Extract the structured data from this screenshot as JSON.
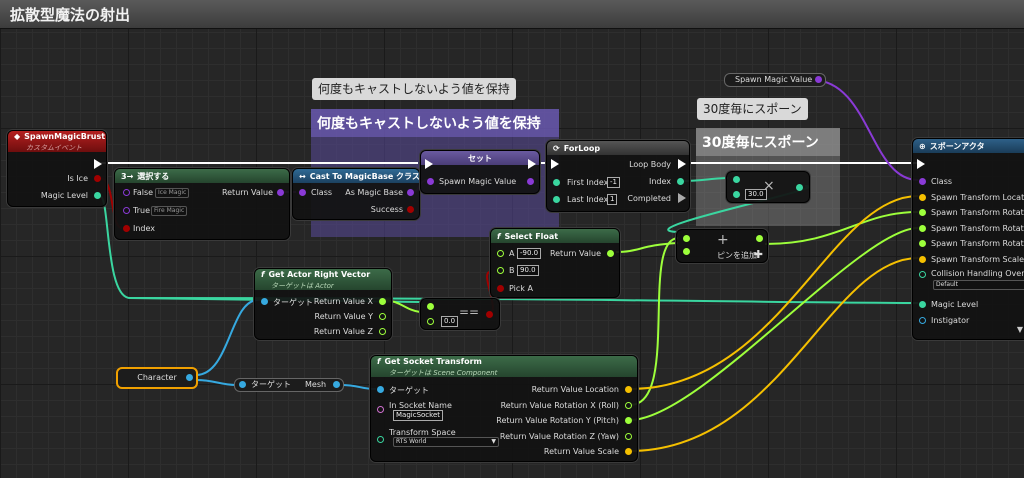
{
  "window": {
    "title": "拡散型魔法の射出"
  },
  "colors": {
    "exec": "#ffffff",
    "bool": "#a10000",
    "float": "#9dff3b",
    "object": "#36a9e0",
    "class": "#8a3ad6",
    "vector": "#f5c000",
    "rotator": "#9dc9f5",
    "actor_header": "#1f4c73",
    "event_header": "#8b1414",
    "pure_header": "#2a5a35",
    "cast_header": "#24557a",
    "set_header": "#6a6a6a",
    "comment_purple": "#5a4a9a",
    "comment_gray": "#8a8a8a"
  },
  "comments": [
    {
      "bubble": "何度もキャストしないよう値を保持",
      "caption": "何度もキャストしないよう値を保持"
    },
    {
      "bubble": "30度毎にスポーン",
      "caption": "30度毎にスポーン"
    }
  ],
  "spawn_magic_brust": {
    "title": "SpawnMagicBrust",
    "subtitle": "カスタムイベント",
    "pins": [
      "Is Ice",
      "Magic Level"
    ]
  },
  "select": {
    "title": "選択する",
    "false_label": "False",
    "false_value": "Ice Magic",
    "true_label": "True",
    "true_value": "Fire Magic",
    "index_label": "Index",
    "return_label": "Return Value"
  },
  "cast": {
    "title": "Cast To MagicBase クラス",
    "class_label": "Class",
    "as_label": "As Magic Base",
    "success_label": "Success"
  },
  "set_node": {
    "title": "セット",
    "var_label": "Spawn Magic Value"
  },
  "spawn_magic_value_getter": {
    "label": "Spawn Magic Value"
  },
  "forloop": {
    "title": "ForLoop",
    "first_index_label": "First Index",
    "first_index_value": "-1",
    "last_index_label": "Last Index",
    "last_index_value": "1",
    "loop_body_label": "Loop Body",
    "index_label": "Index",
    "completed_label": "Completed"
  },
  "multiply": {
    "value": "30.0",
    "symbol": "×"
  },
  "add_node": {
    "symbol": "+",
    "add_pin_label": "ピンを追加"
  },
  "select_float": {
    "title": "Select Float",
    "a_label": "A",
    "a_value": "-90.0",
    "b_label": "B",
    "b_value": "90.0",
    "pick_label": "Pick A",
    "return_label": "Return Value"
  },
  "right_vector": {
    "title": "Get Actor Right Vector",
    "subtitle": "ターゲットは Actor",
    "target_label": "ターゲット",
    "x_label": "Return Value X",
    "y_label": "Return Value Y",
    "z_label": "Return Value Z"
  },
  "equal_node": {
    "symbol": "==",
    "value": "0.0"
  },
  "character": {
    "label": "Character"
  },
  "mesh_getter": {
    "target_label": "ターゲット",
    "label": "Mesh"
  },
  "socket_transform": {
    "title": "Get Socket Transform",
    "subtitle": "ターゲットは Scene Component",
    "target_label": "ターゲット",
    "in_socket_label": "In Socket Name",
    "in_socket_value": "MagicSocket",
    "transform_space_label": "Transform Space",
    "transform_space_value": "RTS World",
    "out_pins": [
      "Return Value Location",
      "Return Value Rotation X (Roll)",
      "Return Value Rotation Y (Pitch)",
      "Return Value Rotation Z (Yaw)",
      "Return Value Scale"
    ]
  },
  "spawn_actor": {
    "title": "スポーンアクタ",
    "pins": [
      "Class",
      "Spawn Transform Location",
      "Spawn Transform Rotation",
      "Spawn Transform Rotation",
      "Spawn Transform Rotation",
      "Spawn Transform Scale"
    ],
    "collision_label": "Collision Handling Override",
    "collision_value": "Default",
    "magic_level_label": "Magic Level",
    "instigator_label": "Instigator"
  }
}
